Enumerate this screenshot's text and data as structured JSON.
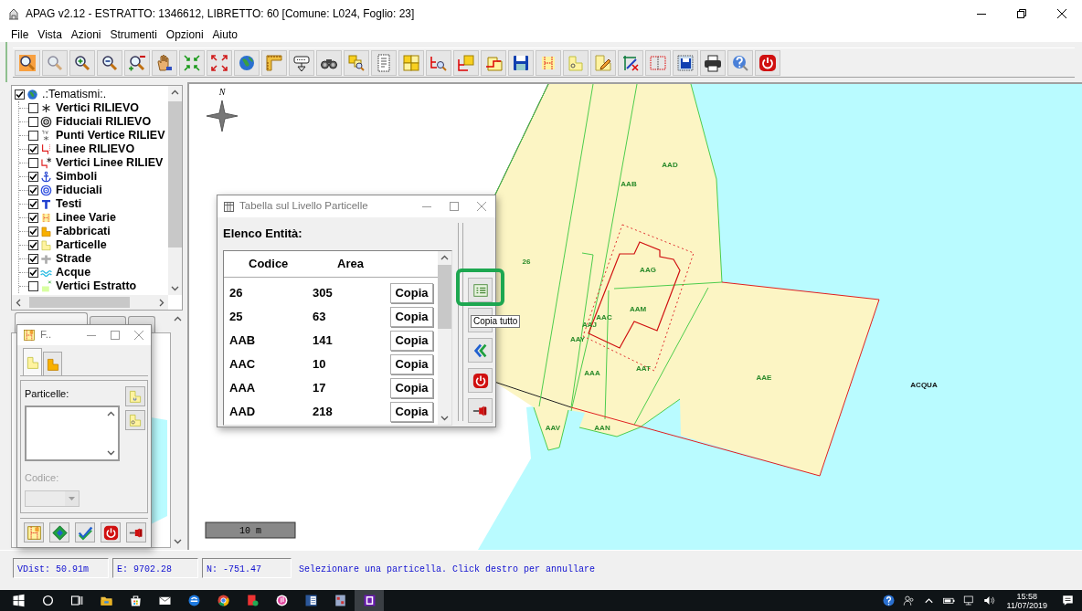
{
  "window": {
    "title": "APAG v2.12 - ESTRATTO: 1346612, LIBRETTO: 60 [Comune: L024, Foglio: 23]"
  },
  "menu": [
    "File",
    "Vista",
    "Azioni",
    "Strumenti",
    "Opzioni",
    "Aiuto"
  ],
  "toolbar": [
    {
      "kind": "zoom-window"
    },
    {
      "kind": "zoom-previous"
    },
    {
      "kind": "zoom-in"
    },
    {
      "kind": "zoom-out"
    },
    {
      "kind": "zoom-extent"
    },
    {
      "kind": "pan"
    },
    {
      "kind": "shrink"
    },
    {
      "kind": "expand"
    },
    {
      "kind": "globe"
    },
    {
      "kind": "ruler"
    },
    {
      "kind": "sign"
    },
    {
      "kind": "binoculars"
    },
    {
      "kind": "select"
    },
    {
      "kind": "dotted-page"
    },
    {
      "kind": "squares"
    },
    {
      "kind": "lines-search"
    },
    {
      "kind": "lines-node"
    },
    {
      "kind": "polygon"
    },
    {
      "kind": "floppy"
    },
    {
      "kind": "dotted-lines"
    },
    {
      "kind": "parcel-number"
    },
    {
      "kind": "pencil"
    },
    {
      "kind": "node-edit"
    },
    {
      "kind": "dotted-square"
    },
    {
      "kind": "floppy-export"
    },
    {
      "kind": "printer"
    },
    {
      "kind": "help"
    },
    {
      "kind": "power"
    }
  ],
  "layers": {
    "label": ".:Tematismi:.",
    "checked": true,
    "children": [
      {
        "label": "Vertici RILIEVO",
        "checked": false,
        "kind": "asterisk"
      },
      {
        "label": "Fiduciali RILIEVO",
        "checked": false,
        "kind": "target"
      },
      {
        "label": "Punti Vertice RILIEV",
        "checked": false,
        "kind": "vertex-points"
      },
      {
        "label": "Linee RILIEVO",
        "checked": true,
        "kind": "red-lines"
      },
      {
        "label": "Vertici Linee RILIEV",
        "checked": false,
        "kind": "red-lines-asterisk"
      },
      {
        "label": "Simboli",
        "checked": true,
        "kind": "anchor"
      },
      {
        "label": "Fiduciali",
        "checked": true,
        "kind": "target-blue"
      },
      {
        "label": "Testi",
        "checked": true,
        "kind": "text-t"
      },
      {
        "label": "Linee Varie",
        "checked": true,
        "kind": "dotted-lines"
      },
      {
        "label": "Fabbricati",
        "checked": true,
        "kind": "building"
      },
      {
        "label": "Particelle",
        "checked": true,
        "kind": "parcel"
      },
      {
        "label": "Strade",
        "checked": true,
        "kind": "road"
      },
      {
        "label": "Acque",
        "checked": true,
        "kind": "water"
      },
      {
        "label": "Vertici Estratto",
        "checked": false,
        "kind": "vertices-green"
      }
    ]
  },
  "overview_tabs": [
    {
      "selected": true
    },
    {
      "selected": false
    },
    {
      "selected": false
    }
  ],
  "map": {
    "compass_label": "N",
    "labels": [
      "26",
      "AAB",
      "AAD",
      "AAG",
      "AAM",
      "AAC",
      "AAJ",
      "AAY",
      "AAA",
      "AAT",
      "AAE",
      "ACQUA",
      "AAV",
      "AAN"
    ],
    "scale_label": "10 m"
  },
  "table_dialog": {
    "title": "Tabella sul Livello Particelle",
    "heading": "Elenco Entità:",
    "columns": [
      "Codice",
      "Area"
    ],
    "rows": [
      {
        "codice": "26",
        "area": "305",
        "action": "Copia"
      },
      {
        "codice": "25",
        "area": "63",
        "action": "Copia"
      },
      {
        "codice": "AAB",
        "area": "141",
        "action": "Copia"
      },
      {
        "codice": "AAC",
        "area": "10",
        "action": "Copia"
      },
      {
        "codice": "AAA",
        "area": "17",
        "action": "Copia"
      },
      {
        "codice": "AAD",
        "area": "218",
        "action": "Copia"
      }
    ],
    "side_buttons": [
      {
        "kind": "copy-all",
        "highlighted": true
      },
      {
        "kind": "arrows",
        "highlighted": false
      },
      {
        "kind": "back",
        "highlighted": false
      },
      {
        "kind": "power",
        "highlighted": false
      },
      {
        "kind": "pin",
        "highlighted": false
      }
    ],
    "tooltip": "Copia tutto"
  },
  "parcel_dialog": {
    "title": "F..",
    "tabs": [
      {
        "kind": "parcel",
        "selected": true
      },
      {
        "kind": "building",
        "selected": false
      }
    ],
    "list_label": "Particelle:",
    "side_buttons": [
      {
        "kind": "parcel-plain"
      },
      {
        "kind": "parcel-number"
      }
    ],
    "code_label": "Codice:",
    "code_disabled": true,
    "buttons": [
      {
        "kind": "map"
      },
      {
        "kind": "diamond"
      },
      {
        "kind": "check"
      },
      {
        "kind": "power"
      },
      {
        "kind": "pin"
      }
    ]
  },
  "status_bar": {
    "fields": [
      "VDist: 50.91m",
      "E: 9702.28",
      "N: -751.47"
    ],
    "message": "Selezionare una particella. Click destro per annullare"
  },
  "taskbar": {
    "apps": [
      {
        "kind": "windows",
        "active": false
      },
      {
        "kind": "search-circle",
        "active": false
      },
      {
        "kind": "task-view",
        "active": false
      },
      {
        "kind": "folder",
        "active": false
      },
      {
        "kind": "store",
        "active": false
      },
      {
        "kind": "mail",
        "active": false
      },
      {
        "kind": "edge",
        "active": false
      },
      {
        "kind": "chrome",
        "active": false
      },
      {
        "kind": "foxit",
        "active": false
      },
      {
        "kind": "itunes",
        "active": false
      },
      {
        "kind": "word",
        "active": false
      },
      {
        "kind": "app",
        "active": false
      },
      {
        "kind": "f-app",
        "active": true
      }
    ],
    "tray": [
      {
        "kind": "help-tray"
      },
      {
        "kind": "people"
      },
      {
        "kind": "caret-up"
      },
      {
        "kind": "battery"
      },
      {
        "kind": "network"
      },
      {
        "kind": "volume"
      }
    ],
    "time": "15:58",
    "date": "11/07/2019",
    "end": [
      {
        "kind": "notification"
      }
    ]
  }
}
